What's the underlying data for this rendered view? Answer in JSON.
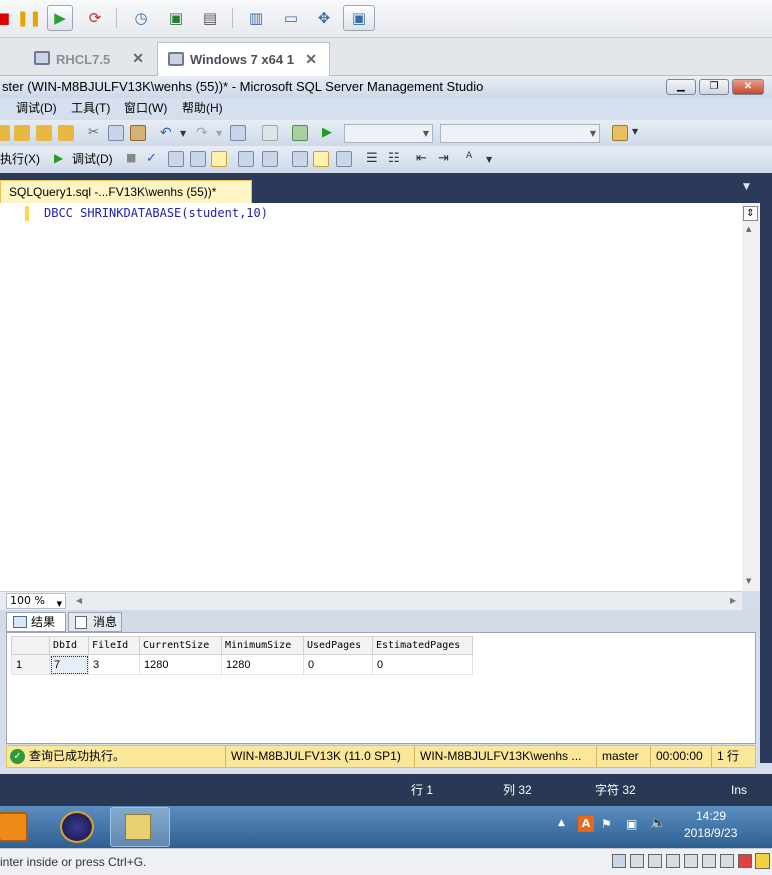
{
  "vm_tabs": [
    {
      "label": "RHCL7.5"
    },
    {
      "label": "Windows 7 x64 1"
    }
  ],
  "ssms": {
    "window_title": "ster (WIN-M8BJULFV13K\\wenhs (55))* - Microsoft SQL Server Management Studio",
    "menu": [
      "调试(D)",
      "工具(T)",
      "窗口(W)",
      "帮助(H)"
    ],
    "toolbar2": {
      "execute_label": "执行(X)",
      "debug_label": "调试(D)"
    },
    "doc_tab": "SQLQuery1.sql -...FV13K\\wenhs (55))*",
    "query": "DBCC SHRINKDATABASE(student,10)",
    "zoom": "100 %",
    "result_tabs": [
      "结果",
      "消息"
    ],
    "grid": {
      "columns": [
        "DbId",
        "FileId",
        "CurrentSize",
        "MinimumSize",
        "UsedPages",
        "EstimatedPages"
      ],
      "rows": [
        {
          "rownum": "1",
          "cells": [
            "7",
            "3",
            "1280",
            "1280",
            "0",
            "0"
          ]
        }
      ]
    },
    "status": {
      "message": "查询已成功执行。",
      "server": "WIN-M8BJULFV13K (11.0 SP1)",
      "user": "WIN-M8BJULFV13K\\wenhs ...",
      "database": "master",
      "elapsed": "00:00:00",
      "rows": "1 行"
    },
    "editor_status": {
      "line": "行 1",
      "col": "列 32",
      "char": "字符 32",
      "mode": "Ins"
    }
  },
  "taskbar": {
    "time": "14:29",
    "date": "2018/9/23"
  },
  "host_status": "inter inside or press Ctrl+G.",
  "colors": {
    "accent_dark": "#293955",
    "status_yellow": "#fbe79a",
    "doc_tab": "#fff4c4"
  }
}
